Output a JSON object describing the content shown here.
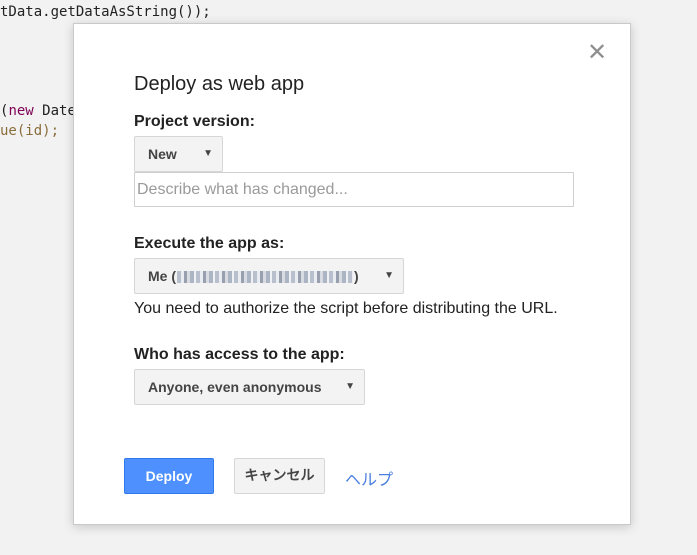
{
  "background_code": {
    "line1": "tData.getDataAsString());",
    "line2_keyword": "new",
    "line2_rest": " Date",
    "line3_fn": "ue",
    "line3_rest": "(id);"
  },
  "dialog": {
    "title": "Deploy as web app",
    "close_glyph": "✕",
    "project_version": {
      "label": "Project version:",
      "selected": "New",
      "description_placeholder": "Describe what has changed...",
      "description_value": ""
    },
    "execute_as": {
      "label": "Execute the app as:",
      "selected_prefix": "Me (",
      "selected_suffix": ")",
      "note": "You need to authorize the script before distributing the URL."
    },
    "access": {
      "label": "Who has access to the app:",
      "selected": "Anyone, even anonymous"
    },
    "buttons": {
      "deploy": "Deploy",
      "cancel": "キャンセル",
      "help": "ヘルプ"
    }
  },
  "dropdown_arrow": "▼",
  "colors": {
    "primary_button": "#4d90fe",
    "link": "#4a7ee0"
  }
}
